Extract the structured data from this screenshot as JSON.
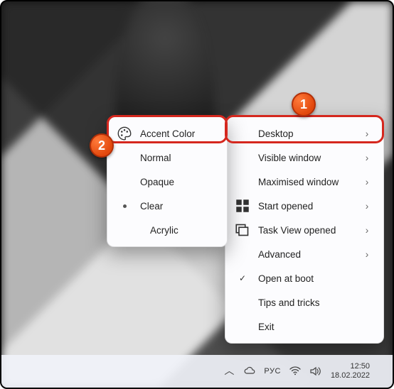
{
  "annotations": {
    "badge1": "1",
    "badge2": "2"
  },
  "menu_right": {
    "items": [
      {
        "label": "Desktop",
        "icon": "",
        "chevron": true
      },
      {
        "label": "Visible window",
        "icon": "",
        "chevron": true
      },
      {
        "label": "Maximised window",
        "icon": "",
        "chevron": true
      },
      {
        "label": "Start opened",
        "icon": "win",
        "chevron": true
      },
      {
        "label": "Task View opened",
        "icon": "taskview",
        "chevron": true
      },
      {
        "label": "Advanced",
        "icon": "",
        "chevron": true
      },
      {
        "label": "Open at boot",
        "icon": "check",
        "chevron": false
      },
      {
        "label": "Tips and tricks",
        "icon": "",
        "chevron": false
      },
      {
        "label": "Exit",
        "icon": "",
        "chevron": false
      }
    ]
  },
  "menu_left": {
    "items": [
      {
        "label": "Accent Color",
        "icon": "palette",
        "indent": false
      },
      {
        "label": "Normal",
        "icon": "",
        "indent": false
      },
      {
        "label": "Opaque",
        "icon": "",
        "indent": false
      },
      {
        "label": "Clear",
        "icon": "bullet",
        "indent": false
      },
      {
        "label": "Acrylic",
        "icon": "",
        "indent": true
      }
    ]
  },
  "taskbar": {
    "lang": "РУС",
    "time": "12:50",
    "date": "18.02.2022"
  }
}
